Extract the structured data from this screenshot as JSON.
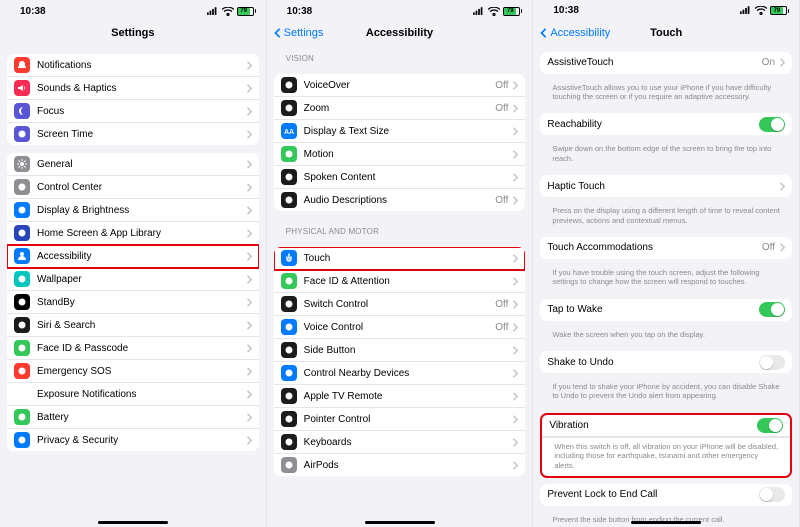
{
  "status": {
    "time": "10:38",
    "battery_pct": "79"
  },
  "phone1": {
    "title": "Settings",
    "groups": [
      {
        "rows": [
          {
            "key": "notifications",
            "label": "Notifications",
            "icon": "bell",
            "color": "#ff3b30"
          },
          {
            "key": "sounds",
            "label": "Sounds & Haptics",
            "icon": "speaker",
            "color": "#ff2d55"
          },
          {
            "key": "focus",
            "label": "Focus",
            "icon": "moon",
            "color": "#5856d6"
          },
          {
            "key": "screentime",
            "label": "Screen Time",
            "icon": "hourglass",
            "color": "#5856d6"
          }
        ]
      },
      {
        "rows": [
          {
            "key": "general",
            "label": "General",
            "icon": "gear",
            "color": "#8e8e93"
          },
          {
            "key": "controlcenter",
            "label": "Control Center",
            "icon": "sliders",
            "color": "#8e8e93"
          },
          {
            "key": "display",
            "label": "Display & Brightness",
            "icon": "sun",
            "color": "#007aff"
          },
          {
            "key": "homescreen",
            "label": "Home Screen & App Library",
            "icon": "grid",
            "color": "#2845ba"
          },
          {
            "key": "accessibility",
            "label": "Accessibility",
            "icon": "person",
            "color": "#007aff",
            "highlight": true
          },
          {
            "key": "wallpaper",
            "label": "Wallpaper",
            "icon": "flower",
            "color": "#00c7be"
          },
          {
            "key": "standby",
            "label": "StandBy",
            "icon": "standby",
            "color": "#000"
          },
          {
            "key": "siri",
            "label": "Siri & Search",
            "icon": "siri",
            "color": "#1c1c1e"
          },
          {
            "key": "faceid",
            "label": "Face ID & Passcode",
            "icon": "face",
            "color": "#34c759"
          },
          {
            "key": "sos",
            "label": "Emergency SOS",
            "icon": "sos",
            "color": "#ff3b30"
          },
          {
            "key": "exposure",
            "label": "Exposure Notifications",
            "icon": "exposure",
            "color": "#fff",
            "grayIcon": true
          },
          {
            "key": "battery",
            "label": "Battery",
            "icon": "battery",
            "color": "#34c759"
          },
          {
            "key": "privacy",
            "label": "Privacy & Security",
            "icon": "hand",
            "color": "#007aff"
          }
        ]
      }
    ]
  },
  "phone2": {
    "back": "Settings",
    "title": "Accessibility",
    "groups": [
      {
        "header": "VISION",
        "rows": [
          {
            "key": "voiceover",
            "label": "VoiceOver",
            "icon": "voiceover",
            "color": "#1c1c1e",
            "value": "Off"
          },
          {
            "key": "zoom",
            "label": "Zoom",
            "icon": "zoom",
            "color": "#1c1c1e",
            "value": "Off"
          },
          {
            "key": "displaytext",
            "label": "Display & Text Size",
            "icon": "aa",
            "color": "#007aff"
          },
          {
            "key": "motion",
            "label": "Motion",
            "icon": "motion",
            "color": "#34c759"
          },
          {
            "key": "spoken",
            "label": "Spoken Content",
            "icon": "speak",
            "color": "#1c1c1e"
          },
          {
            "key": "audiodesc",
            "label": "Audio Descriptions",
            "icon": "ad",
            "color": "#1c1c1e",
            "value": "Off"
          }
        ]
      },
      {
        "header": "PHYSICAL AND MOTOR",
        "rows": [
          {
            "key": "touch",
            "label": "Touch",
            "icon": "touch",
            "color": "#007aff",
            "highlight": true
          },
          {
            "key": "faceid2",
            "label": "Face ID & Attention",
            "icon": "face",
            "color": "#34c759"
          },
          {
            "key": "switchcontrol",
            "label": "Switch Control",
            "icon": "switch",
            "color": "#1c1c1e",
            "value": "Off"
          },
          {
            "key": "voicecontrol",
            "label": "Voice Control",
            "icon": "voice",
            "color": "#007aff",
            "value": "Off"
          },
          {
            "key": "sidebutton",
            "label": "Side Button",
            "icon": "side",
            "color": "#1c1c1e"
          },
          {
            "key": "nearby",
            "label": "Control Nearby Devices",
            "icon": "nearby",
            "color": "#007aff"
          },
          {
            "key": "appletv",
            "label": "Apple TV Remote",
            "icon": "tv",
            "color": "#1c1c1e"
          },
          {
            "key": "pointer",
            "label": "Pointer Control",
            "icon": "pointer",
            "color": "#1c1c1e"
          },
          {
            "key": "keyboards",
            "label": "Keyboards",
            "icon": "keyboard",
            "color": "#1c1c1e"
          },
          {
            "key": "airpods",
            "label": "AirPods",
            "icon": "airpods",
            "color": "#8e8e93"
          }
        ]
      }
    ]
  },
  "phone3": {
    "back": "Accessibility",
    "title": "Touch",
    "sections": [
      {
        "type": "group",
        "rows": [
          {
            "key": "assistivetouch",
            "label": "AssistiveTouch",
            "value": "On",
            "chev": true
          }
        ],
        "footer": "AssistiveTouch allows you to use your iPhone if you have difficulty touching the screen or if you require an adaptive accessory."
      },
      {
        "type": "group",
        "rows": [
          {
            "key": "reachability",
            "label": "Reachability",
            "toggle": "on"
          }
        ],
        "footer": "Swipe down on the bottom edge of the screen to bring the top into reach."
      },
      {
        "type": "group",
        "rows": [
          {
            "key": "haptictouch",
            "label": "Haptic Touch",
            "chev": true
          }
        ],
        "footer": "Press on the display using a different length of time to reveal content previews, actions and contextual menus."
      },
      {
        "type": "group",
        "rows": [
          {
            "key": "touchaccom",
            "label": "Touch Accommodations",
            "value": "Off",
            "chev": true
          }
        ],
        "footer": "If you have trouble using the touch screen, adjust the following settings to change how the screen will respond to touches."
      },
      {
        "type": "group",
        "rows": [
          {
            "key": "taptowake",
            "label": "Tap to Wake",
            "toggle": "on"
          }
        ],
        "footer": "Wake the screen when you tap on the display."
      },
      {
        "type": "group",
        "rows": [
          {
            "key": "shaketoundo",
            "label": "Shake to Undo",
            "toggle": "off"
          }
        ],
        "footer": "If you tend to shake your iPhone by accident, you can disable Shake to Undo to prevent the Undo alert from appearing."
      },
      {
        "type": "group",
        "highlight": true,
        "rows": [
          {
            "key": "vibration",
            "label": "Vibration",
            "toggle": "on"
          }
        ],
        "footer": "When this switch is off, all vibration on your iPhone will be disabled, including those for earthquake, tsunami and other emergency alerts.",
        "footerInside": true
      },
      {
        "type": "group",
        "rows": [
          {
            "key": "preventlock",
            "label": "Prevent Lock to End Call",
            "toggle": "off"
          }
        ],
        "footer": "Prevent the side button from ending the current call."
      }
    ]
  }
}
